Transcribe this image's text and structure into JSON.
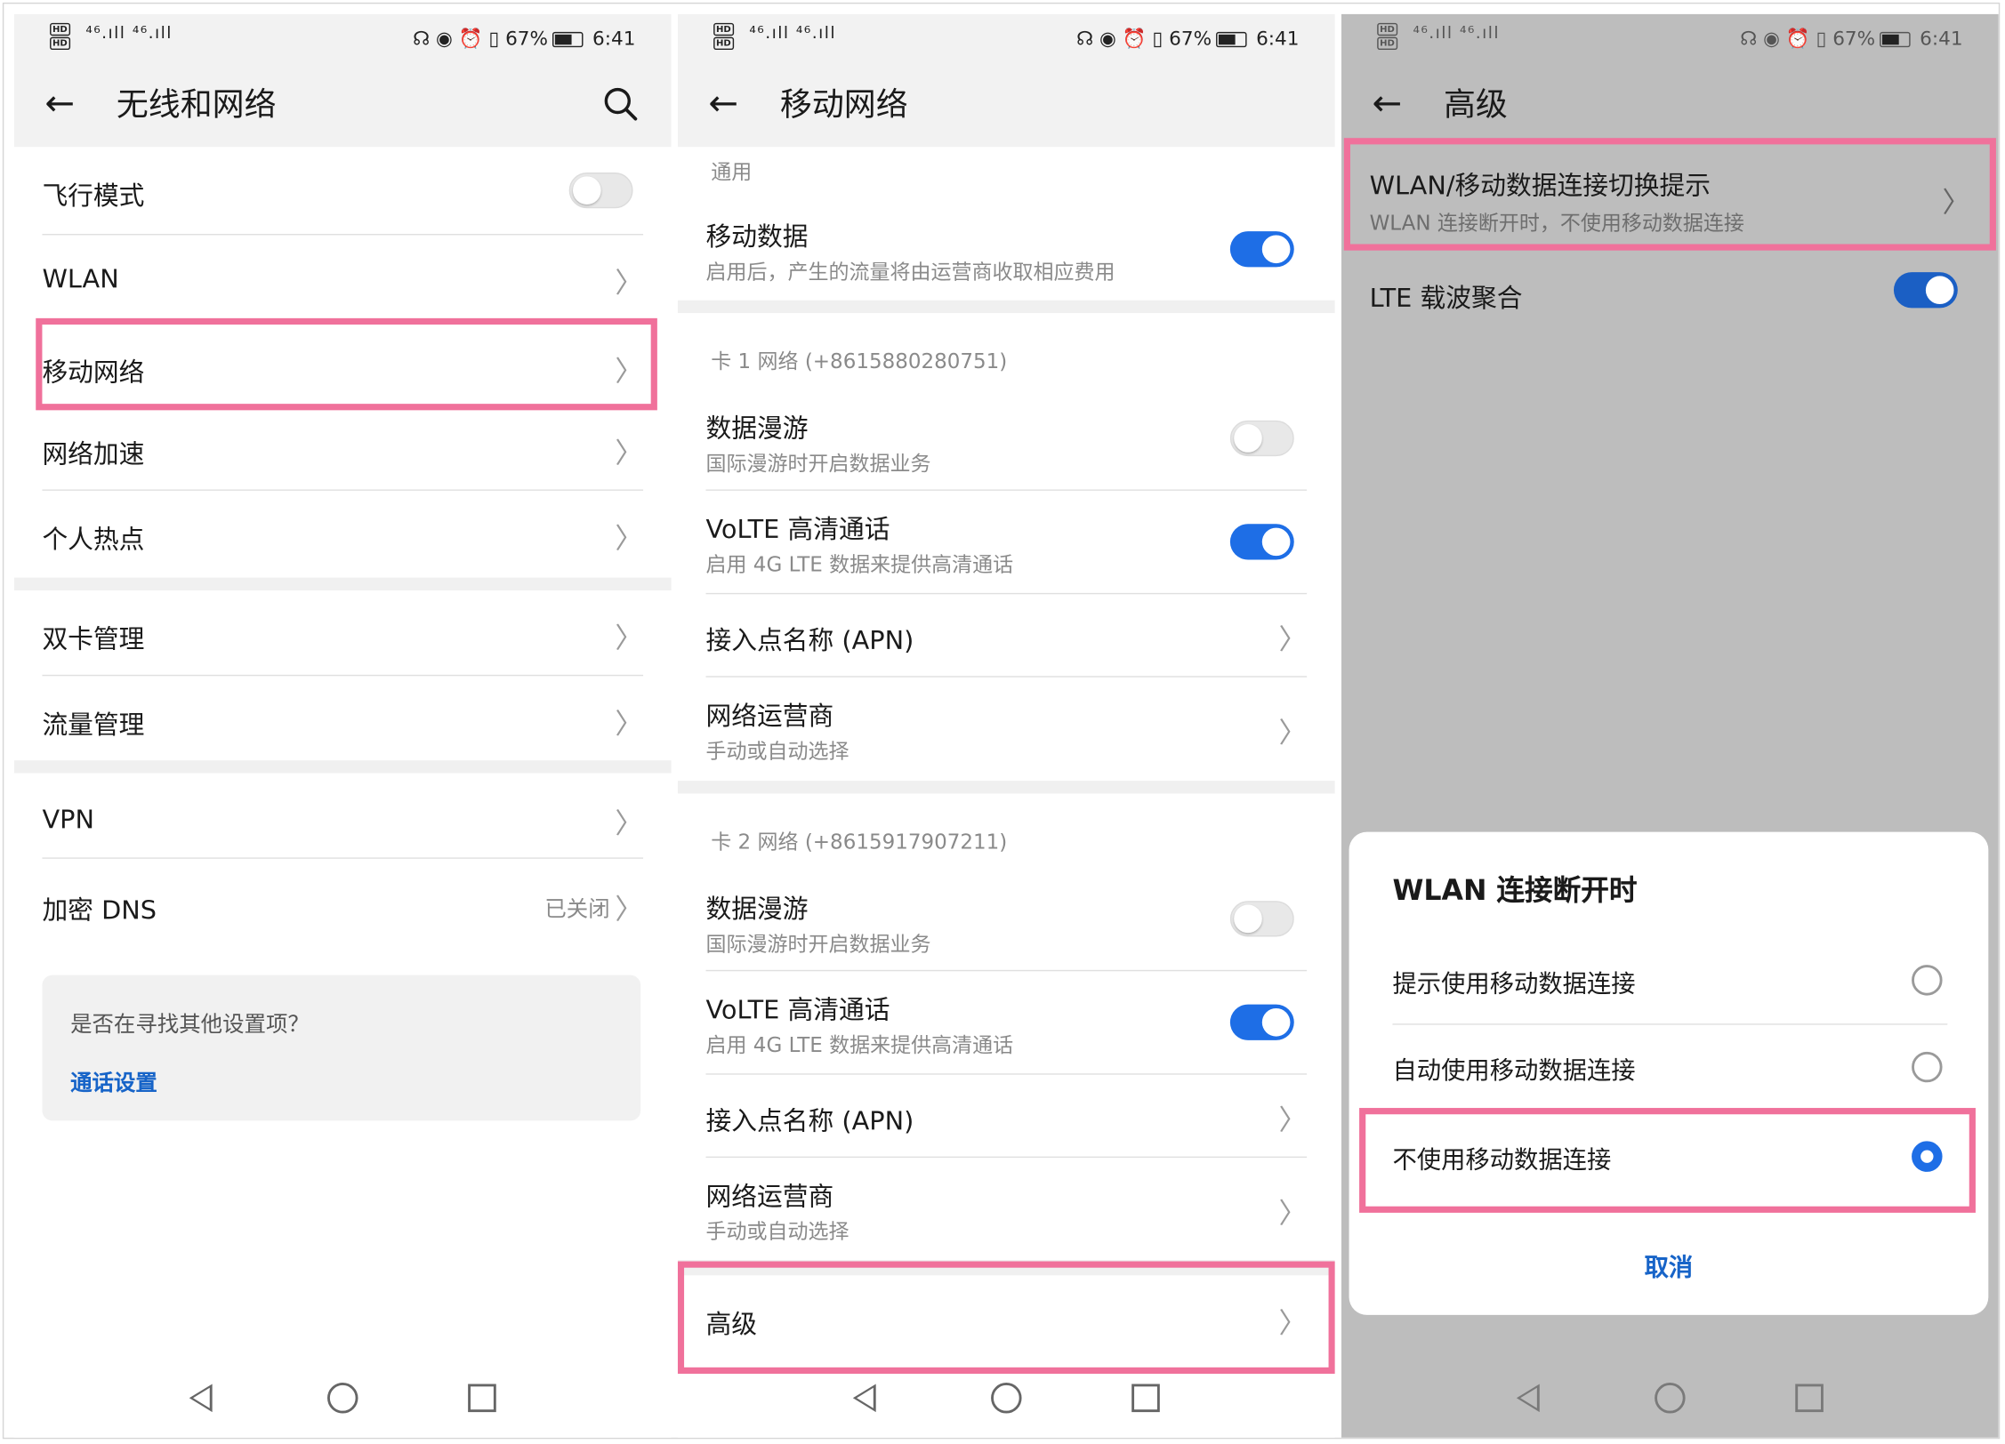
{
  "status": {
    "left_badges": [
      "HD",
      "HD"
    ],
    "signal": "⁴⁶.ıll ⁴⁶.ıll",
    "right_icons": "☊ ◉ ⏰ ▯",
    "battery_pct": "67%",
    "time": "6:41"
  },
  "panel1": {
    "title": "无线和网络",
    "items": [
      {
        "label": "飞行模式"
      },
      {
        "label": "WLAN"
      },
      {
        "label": "移动网络"
      },
      {
        "label": "网络加速"
      },
      {
        "label": "个人热点"
      },
      {
        "label": "双卡管理"
      },
      {
        "label": "流量管理"
      },
      {
        "label": "VPN"
      },
      {
        "label": "加密 DNS",
        "value": "已关闭"
      }
    ],
    "card": {
      "question": "是否在寻找其他设置项？",
      "link": "通话设置"
    }
  },
  "panel2": {
    "title": "移动网络",
    "general_section": "通用",
    "mobile_data": {
      "label": "移动数据",
      "sub": "启用后，产生的流量将由运营商收取相应费用"
    },
    "sim1_section": "卡 1 网络 (+8615880280751)",
    "sim2_section": "卡 2 网络 (+8615917907211)",
    "roaming": {
      "label": "数据漫游",
      "sub": "国际漫游时开启数据业务"
    },
    "volte": {
      "label": "VoLTE 高清通话",
      "sub": "启用 4G LTE 数据来提供高清通话"
    },
    "apn": {
      "label": "接入点名称 (APN)"
    },
    "carrier": {
      "label": "网络运营商",
      "sub": "手动或自动选择"
    },
    "advanced": {
      "label": "高级"
    }
  },
  "panel3": {
    "title": "高级",
    "wlan_switch": {
      "label": "WLAN/移动数据连接切换提示",
      "sub": "WLAN 连接断开时，不使用移动数据连接"
    },
    "lte_ca": {
      "label": "LTE 载波聚合"
    },
    "dialog": {
      "title": "WLAN 连接断开时",
      "options": [
        "提示使用移动数据连接",
        "自动使用移动数据连接",
        "不使用移动数据连接"
      ],
      "selected_index": 2,
      "cancel": "取消"
    }
  },
  "icons": {
    "back": "arrow-left",
    "search": "magnifier",
    "chevron": "chevron-right"
  },
  "colors": {
    "accent": "#1e6ee6",
    "highlight": "#f0719b",
    "link": "#1764c8"
  }
}
